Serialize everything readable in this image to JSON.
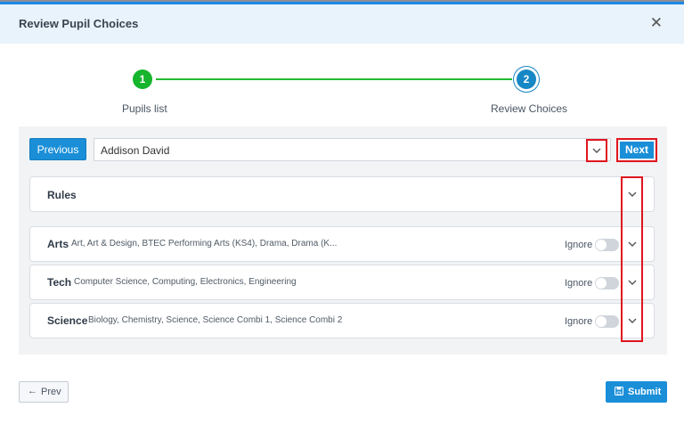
{
  "modal": {
    "title": "Review Pupil Choices",
    "close_icon": "close-icon"
  },
  "stepper": {
    "steps": [
      {
        "number": "1",
        "label": "Pupils list",
        "status": "complete",
        "color": "#16b52d"
      },
      {
        "number": "2",
        "label": "Review Choices",
        "status": "active",
        "color": "#1787c5"
      }
    ]
  },
  "nav": {
    "previous_label": "Previous",
    "next_label": "Next",
    "selected_pupil": "Addison David"
  },
  "rules": {
    "title": "Rules"
  },
  "subjects": [
    {
      "name": "Arts",
      "courses": "Art, Art & Design, BTEC Performing Arts (KS4), Drama, Drama (K...",
      "ignore_label": "Ignore",
      "ignore_on": false
    },
    {
      "name": "Tech",
      "courses": "Computer Science, Computing, Electronics, Engineering",
      "ignore_label": "Ignore",
      "ignore_on": false
    },
    {
      "name": "Science",
      "courses": "Biology, Chemistry, Science, Science Combi 1, Science Combi 2",
      "ignore_label": "Ignore",
      "ignore_on": false
    }
  ],
  "footer": {
    "prev_label": "Prev",
    "submit_label": "Submit"
  },
  "colors": {
    "accent": "#1a8fd8",
    "step_complete": "#16b52d",
    "highlight": "#e0151e"
  }
}
